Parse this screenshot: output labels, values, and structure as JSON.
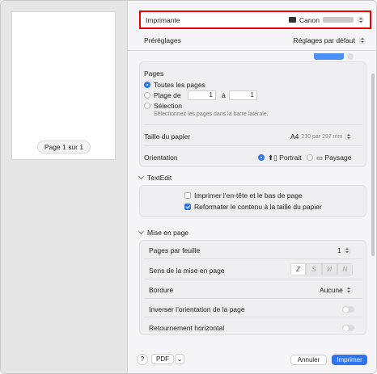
{
  "preview": {
    "page_indicator": "Page 1 sur 1"
  },
  "printer": {
    "label": "Imprimante",
    "value": "Canon",
    "icon": "printer-icon"
  },
  "presets": {
    "label": "Préréglages",
    "value": "Réglages par défaut"
  },
  "pages": {
    "title": "Pages",
    "all_pages": "Toutes les pages",
    "range_label": "Plage de",
    "range_from": "1",
    "range_to_label": "à",
    "range_to": "1",
    "selection_label": "Sélection",
    "selection_hint": "Sélectionnez les pages dans la barre latérale."
  },
  "paper": {
    "label": "Taille du papier",
    "size": "A4",
    "dimensions": "210 par 297 mm"
  },
  "orientation": {
    "label": "Orientation",
    "portrait": "Portrait",
    "landscape": "Paysage"
  },
  "textedit": {
    "title": "TextEdit",
    "header_footer": "Imprimer l’en-tête et le bas de page",
    "rewrap": "Reformater le contenu à la taille du papier"
  },
  "layout": {
    "title": "Mise en page",
    "pages_per_sheet_label": "Pages par feuille",
    "pages_per_sheet_value": "1",
    "direction_label": "Sens de la mise en page",
    "direction_options": [
      "Z",
      "S",
      "И",
      "N"
    ],
    "border_label": "Bordure",
    "border_value": "Aucune",
    "reverse_label": "Inverser l’orientation de la page",
    "flip_label": "Retournement horizontal"
  },
  "footer": {
    "help": "?",
    "pdf": "PDF",
    "cancel": "Annuler",
    "print": "Imprimer"
  },
  "colors": {
    "accent": "#2e74f0",
    "highlight": "#ee0000"
  }
}
